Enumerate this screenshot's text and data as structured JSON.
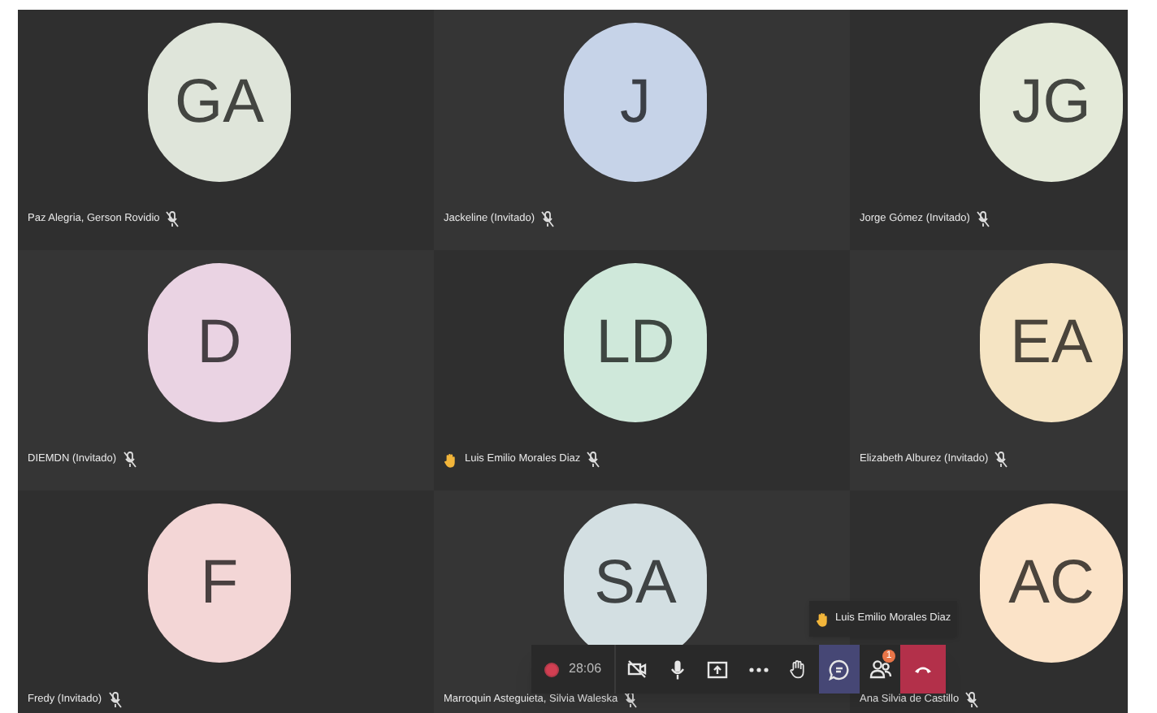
{
  "tiles": [
    {
      "initials": "GA",
      "name": "Paz Alegria, Gerson Rovidio",
      "color": "#dfe5da",
      "hand_raised": false,
      "muted": true
    },
    {
      "initials": "J",
      "name": "Jackeline (Invitado)",
      "color": "#c6d3e8",
      "hand_raised": false,
      "muted": true
    },
    {
      "initials": "JG",
      "name": "Jorge Gómez (Invitado)",
      "color": "#e4ead9",
      "hand_raised": false,
      "muted": true
    },
    {
      "initials": "D",
      "name": "DIEMDN (Invitado)",
      "color": "#ead3e3",
      "hand_raised": false,
      "muted": true
    },
    {
      "initials": "LD",
      "name": "Luis Emilio Morales Diaz",
      "color": "#cfe8da",
      "hand_raised": true,
      "muted": true
    },
    {
      "initials": "EA",
      "name": "Elizabeth Alburez (Invitado)",
      "color": "#f5e4c3",
      "hand_raised": false,
      "muted": true
    },
    {
      "initials": "F",
      "name": "Fredy (Invitado)",
      "color": "#f3d6d6",
      "hand_raised": false,
      "muted": true
    },
    {
      "initials": "SA",
      "name": "Marroquin Asteguieta, Silvia Waleska",
      "color": "#d3dfe2",
      "hand_raised": false,
      "muted": true
    },
    {
      "initials": "AC",
      "name": "Ana Silvia de Castillo",
      "color": "#fbe3c8",
      "hand_raised": false,
      "muted": true
    }
  ],
  "toolbar": {
    "recording": true,
    "time": "28:06",
    "buttons": [
      {
        "kind": "camera-off",
        "selected": false
      },
      {
        "kind": "mic",
        "selected": false
      },
      {
        "kind": "share",
        "selected": false
      },
      {
        "kind": "more",
        "selected": false
      },
      {
        "kind": "hand",
        "selected": false
      },
      {
        "kind": "chat",
        "selected": true
      },
      {
        "kind": "people",
        "selected": false,
        "badge": "1"
      },
      {
        "kind": "hangup",
        "selected": false
      }
    ]
  },
  "notification": {
    "name": "Luis Emilio Morales Diaz",
    "hand_raised": true
  }
}
